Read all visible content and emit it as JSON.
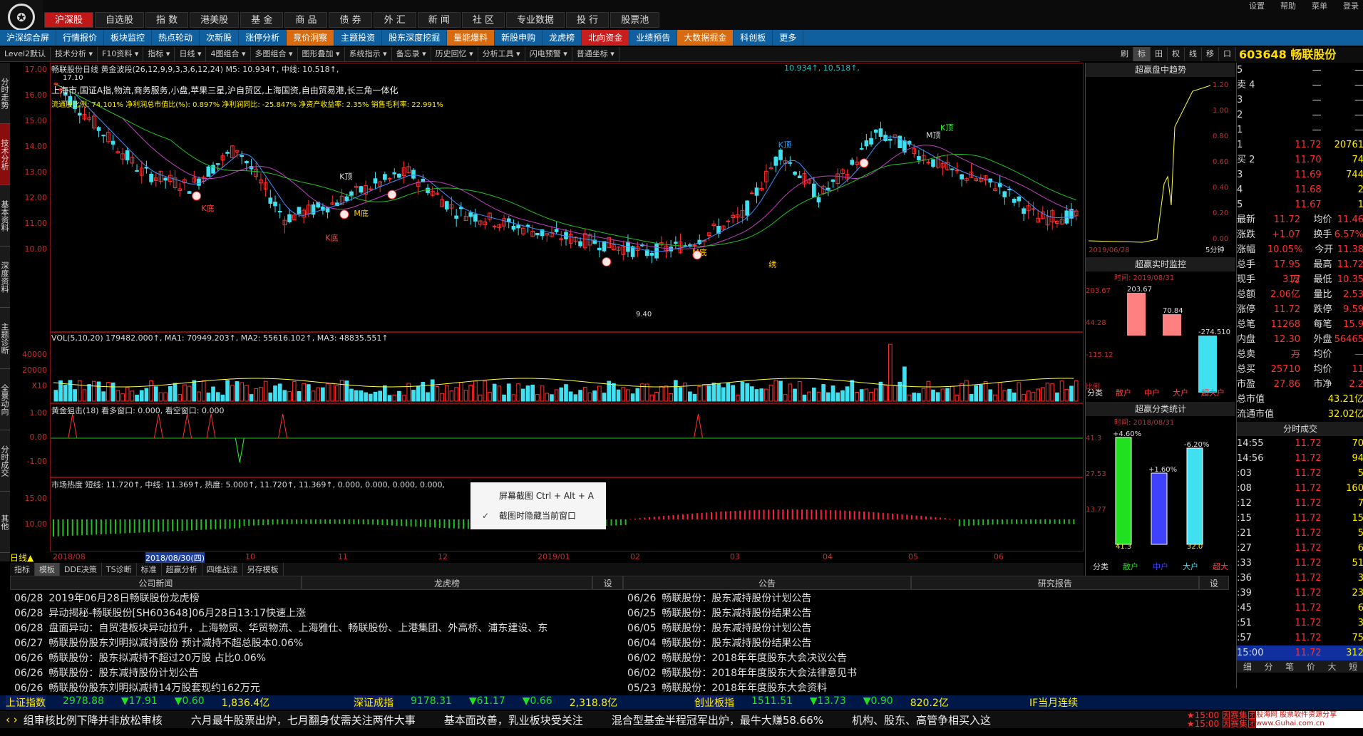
{
  "window": {
    "controls": [
      "设置",
      "帮助",
      "菜单",
      "登录"
    ]
  },
  "nav1": [
    "沪深股",
    "自选股",
    "指 数",
    "港美股",
    "基 金",
    "商 品",
    "债 券",
    "外 汇",
    "新 闻",
    "社 区",
    "专业数据",
    "投 行",
    "股票池"
  ],
  "nav2": [
    {
      "label": "沪深综合屏",
      "style": "normal"
    },
    {
      "label": "行情报价",
      "style": "normal"
    },
    {
      "label": "板块监控",
      "style": "normal"
    },
    {
      "label": "热点轮动",
      "style": "normal"
    },
    {
      "label": "次新股",
      "style": "normal"
    },
    {
      "label": "涨停分析",
      "style": "normal"
    },
    {
      "label": "竞价洞察",
      "style": "orange"
    },
    {
      "label": "主题投资",
      "style": "normal"
    },
    {
      "label": "股东深度挖掘",
      "style": "normal"
    },
    {
      "label": "量能爆料",
      "style": "orange"
    },
    {
      "label": "新股申购",
      "style": "normal"
    },
    {
      "label": "龙虎榜",
      "style": "normal"
    },
    {
      "label": "北向资金",
      "style": "red"
    },
    {
      "label": "业绩预告",
      "style": "normal"
    },
    {
      "label": "大数据掘金",
      "style": "orange"
    },
    {
      "label": "科创板",
      "style": "normal"
    },
    {
      "label": "更多",
      "style": "normal"
    }
  ],
  "toolbar": [
    "Level2默认",
    "技术分析",
    "F10资料",
    "指标",
    "日线",
    "4图组合",
    "多图组合",
    "图形叠加",
    "系统指示",
    "备忘录",
    "历史回忆",
    "分析工具",
    "闪电预警",
    "普通坐标"
  ],
  "toolbar_right": [
    "刷",
    "标",
    "田",
    "权",
    "线",
    "移",
    "口"
  ],
  "side_tabs": [
    "分时走势",
    "技术分析",
    "基本资料",
    "深度资料",
    "主题诊断",
    "全景动向",
    "分时成交",
    "其他"
  ],
  "chart": {
    "header": "畅联股份日线  黄金波段(26,12,9,9,3,3,6,12,24) M5: 10.934↑, 中线: 10.518↑,",
    "tags": "上海市,国证A指,物流,商务服务,小盘,苹果三星,沪自贸区,上海国资,自由贸易港,长三角一体化",
    "ratios": "流通股比例: 74.101%  净利润总市值比(%): 0.897%  净利润同比: -25.847%  净资产收益率: 2.35%  销售毛利率: 22.991%",
    "price_axis": [
      "17.00",
      "16.00",
      "15.00",
      "14.00",
      "13.00",
      "12.00",
      "11.00",
      "10.00"
    ],
    "high_label": "17.10",
    "low_label": "9.40",
    "top_right_vals": "10.934↑, 10.518↑,",
    "markers": [
      "K顶",
      "M顶",
      "K顶",
      "K顶",
      "M底",
      "K底",
      "K底",
      "M底",
      "绣"
    ],
    "date_axis": [
      "2018/08",
      "2018/08/30(四)",
      "10",
      "11",
      "12",
      "2019/01",
      "02",
      "03",
      "04",
      "05",
      "06"
    ],
    "period_label": "日线"
  },
  "vol": {
    "header": "VOL(5,10,20)  179482.000↑, MA1: 70949.203↑, MA2: 55616.102↑, MA3: 48835.551↑",
    "axis": [
      "40000",
      "20000",
      "X10"
    ]
  },
  "gold": {
    "header": "黄金狙击(18)  看多窗口: 0.000, 看空窗口: 0.000",
    "axis": [
      "1.00",
      "0.00",
      "-1.00"
    ]
  },
  "heat": {
    "header": "市场热度  短线: 11.720↑, 中线: 11.369↑, 热度: 5.000↑, 11.720↑, 11.369↑, 0.000, 0.000, 0.000, 0.000,",
    "axis": [
      "15.00",
      "10.00"
    ]
  },
  "bottom_tabs": [
    "指标",
    "模板",
    "DDE决策",
    "TS诊断",
    "标准",
    "超赢分析",
    "四维战法",
    "另存模板"
  ],
  "super_panel": {
    "title1": "超赢盘中趋势",
    "axis1": [
      "1.20",
      "1.00",
      "0.80",
      "0.60",
      "0.40",
      "0.20",
      "0.00"
    ],
    "date1": "2019/06/28",
    "label1": "5分钟",
    "title2": "超赢实时监控",
    "sub2": "时间: 2019/08/31",
    "vals2": [
      "203.67",
      "70.84",
      "-274.510"
    ],
    "axis2": [
      "203.67",
      "44.28",
      "-115.12",
      "比例"
    ],
    "cats2": [
      "分类",
      "散户",
      "中户",
      "大户",
      "超大户"
    ],
    "title3": "超赢分类统计",
    "sub3": "时间: 2018/08/31",
    "vals3": [
      "+4.60%",
      "+1.60%",
      "-6.20%"
    ],
    "axis3": [
      "41.3",
      "27.53",
      "13.77"
    ],
    "bottom3": [
      "41.3",
      "",
      "32.0",
      ""
    ],
    "cats3": [
      "分类",
      "散户",
      "中户",
      "大户",
      "超大"
    ]
  },
  "quote": {
    "code": "603648",
    "name": "畅联股份",
    "sell": [
      [
        "5",
        "—",
        "—"
      ],
      [
        "4",
        "—",
        "—"
      ],
      [
        "3",
        "—",
        "—"
      ],
      [
        "2",
        "—",
        "—"
      ],
      [
        "1",
        "—",
        "—"
      ]
    ],
    "buy": [
      [
        "1",
        "11.72",
        "20761"
      ],
      [
        "2",
        "11.70",
        "74"
      ],
      [
        "3",
        "11.69",
        "744"
      ],
      [
        "4",
        "11.68",
        "2"
      ],
      [
        "5",
        "11.67",
        "1"
      ]
    ],
    "stats": [
      [
        "最新",
        "11.72",
        "均价",
        "11.46"
      ],
      [
        "涨跌",
        "+1.07",
        "换手",
        "6.57%"
      ],
      [
        "涨幅",
        "10.05%",
        "今开",
        "11.38"
      ],
      [
        "总手",
        "17.95万",
        "最高",
        "11.72"
      ],
      [
        "现手",
        "312",
        "最低",
        "10.35"
      ],
      [
        "总额",
        "2.06亿",
        "量比",
        "2.53"
      ],
      [
        "涨停",
        "11.72",
        "跌停",
        "9.59"
      ],
      [
        "总笔",
        "11268",
        "每笔",
        "15.9"
      ],
      [
        "内盘",
        "12.30万",
        "外盘",
        "56465"
      ],
      [
        "总卖",
        "—",
        "均价",
        "—"
      ],
      [
        "总买",
        "25710",
        "均价",
        "11"
      ],
      [
        "市盈",
        "27.86",
        "市净",
        "2.2"
      ]
    ],
    "mktcap": [
      [
        "总市值",
        "43.21亿"
      ],
      [
        "流通市值",
        "32.02亿"
      ]
    ],
    "ticks_title": "分时成交",
    "ticks": [
      [
        "14:55",
        "11.72",
        "70"
      ],
      [
        "14:56",
        "11.72",
        "94"
      ],
      [
        ":03",
        "11.72",
        "5"
      ],
      [
        ":08",
        "11.72",
        "160"
      ],
      [
        ":12",
        "11.72",
        "7"
      ],
      [
        ":15",
        "11.72",
        "15"
      ],
      [
        ":21",
        "11.72",
        "5"
      ],
      [
        ":27",
        "11.72",
        "6"
      ],
      [
        ":33",
        "11.72",
        "51"
      ],
      [
        ":36",
        "11.72",
        "3"
      ],
      [
        ":39",
        "11.72",
        "23"
      ],
      [
        ":45",
        "11.72",
        "6"
      ],
      [
        ":51",
        "11.72",
        "3"
      ],
      [
        ":57",
        "11.72",
        "75"
      ],
      [
        "15:00",
        "11.72",
        "312"
      ]
    ],
    "bottom_tabs": [
      "细",
      "分",
      "笔",
      "价",
      "大",
      "短"
    ]
  },
  "news": {
    "tabs_left": [
      "公司新闻",
      "龙虎榜",
      "设"
    ],
    "tabs_right": [
      "公告",
      "研究报告",
      "设"
    ],
    "left": [
      [
        "06/28",
        "2019年06月28日畅联股份龙虎榜"
      ],
      [
        "06/28",
        "异动揭秘-畅联股份[SH603648]06月28日13:17快速上涨"
      ],
      [
        "06/28",
        "盘面异动：自贸港板块异动拉升，上海物贸、华贸物流、上海雅仕、畅联股份、上港集团、外高桥、浦东建设、东"
      ],
      [
        "06/27",
        "畅联股份股东刘明拟减持股份 预计减持不超总股本0.06%"
      ],
      [
        "06/26",
        "畅联股份：股东拟减持不超过20万股 占比0.06%"
      ],
      [
        "06/26",
        "畅联股份：股东减持股份计划公告"
      ],
      [
        "06/26",
        "畅联股份股东刘明拟减持14万股套现约162万元"
      ]
    ],
    "right": [
      [
        "06/26",
        "畅联股份：股东减持股份计划公告"
      ],
      [
        "06/25",
        "畅联股份：股东减持股份结果公告"
      ],
      [
        "06/05",
        "畅联股份：股东减持股份计划公告"
      ],
      [
        "06/04",
        "畅联股份：股东减持股份结果公告"
      ],
      [
        "06/02",
        "畅联股份：2018年年度股东大会决议公告"
      ],
      [
        "06/02",
        "畅联股份：2018年年度股东大会法律意见书"
      ],
      [
        "05/23",
        "畅联股份：2018年年度股东大会资料"
      ]
    ]
  },
  "ticker": {
    "items": [
      {
        "name": "上证指数",
        "val": "2978.88",
        "chg": "▼17.91",
        "pct": "▼0.60",
        "amt": "1,836.4亿"
      },
      {
        "name": "深证成指",
        "val": "9178.31",
        "chg": "▼61.17",
        "pct": "▼0.66",
        "amt": "2,318.8亿"
      },
      {
        "name": "创业板指",
        "val": "1511.51",
        "chg": "▼13.73",
        "pct": "▼0.90",
        "amt": "820.2亿"
      }
    ],
    "last": "IF当月连续",
    "scroll": [
      "组审核比例下降并非放松审核",
      "六月最牛股票出炉，七月翻身仗需关注两件大事",
      "基本面改善，乳业板块受关注",
      "混合型基金半程冠军出炉，最牛大赚58.66%",
      "机构、股东、高管争相买入这"
    ],
    "alerts": [
      "★15:00 因赛集团",
      "★15:00 因赛集团"
    ],
    "watermark": "股海网 股票软件资源分享 www.Guhai.com.cn"
  },
  "context_menu": {
    "items": [
      "屏幕截图 Ctrl + Alt + A",
      "截图时隐藏当前窗口"
    ]
  }
}
